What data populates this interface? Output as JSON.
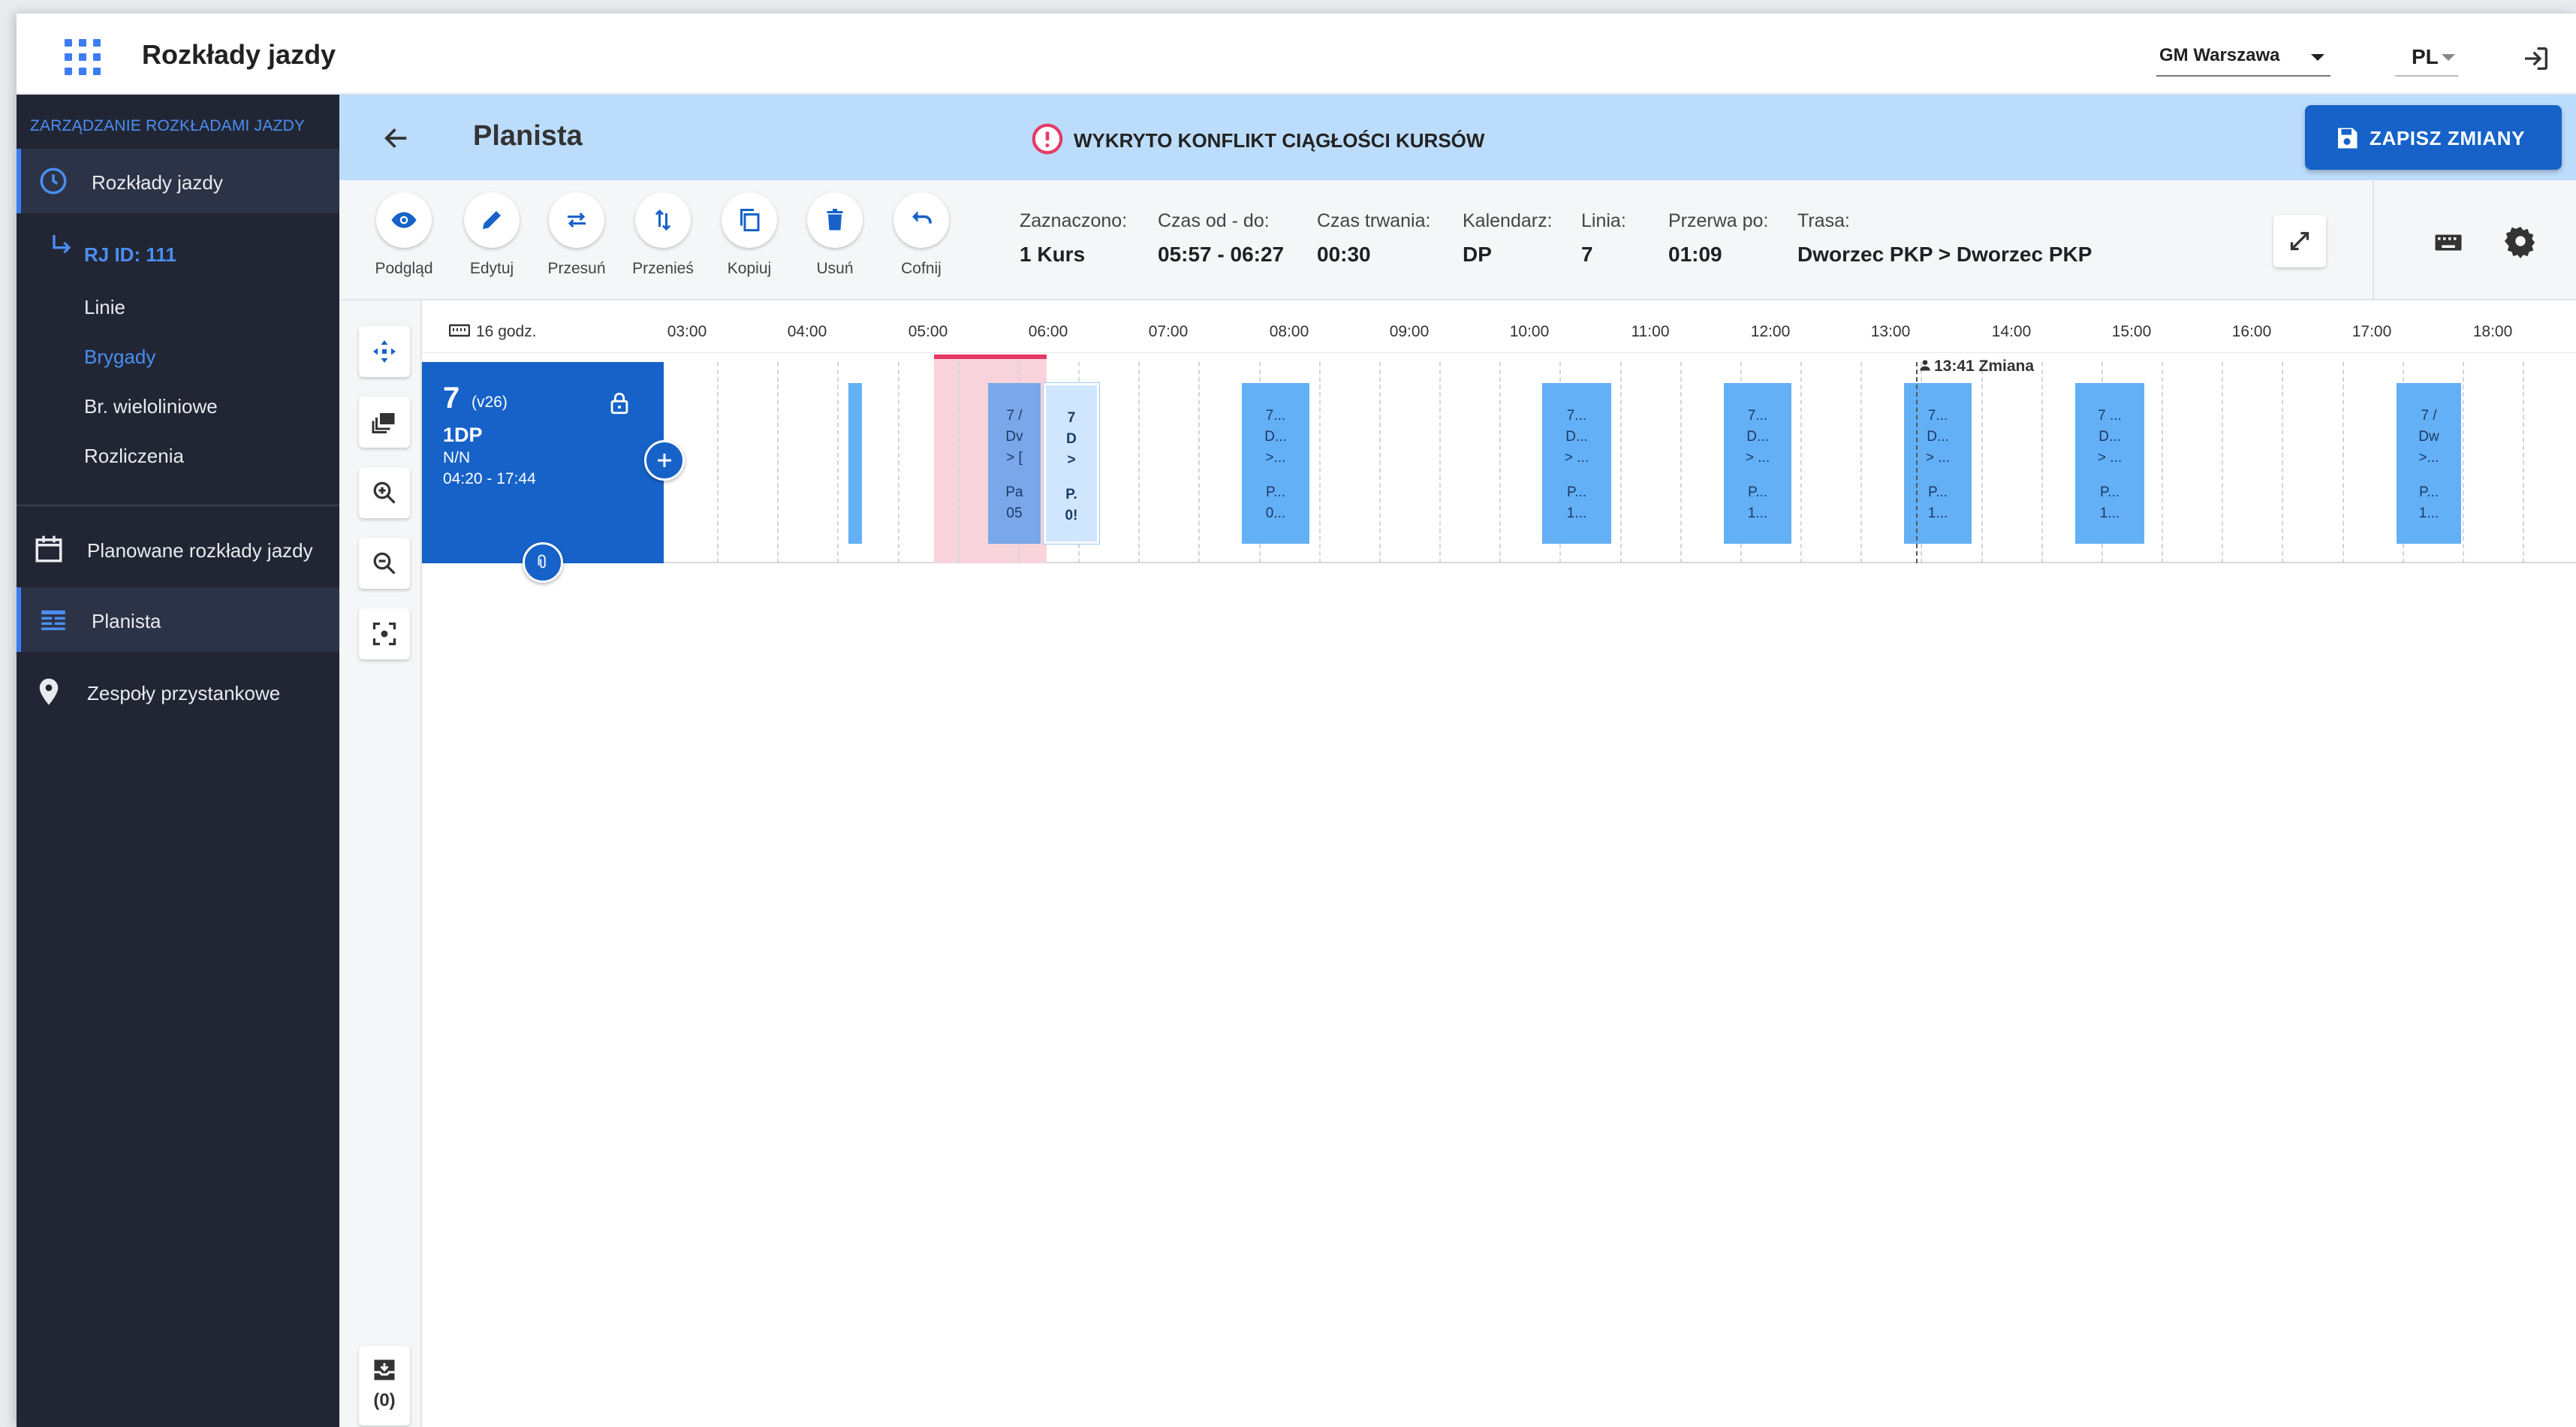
{
  "app": {
    "title": "Rozkłady jazdy",
    "org": "GM Warszawa",
    "lang": "PL"
  },
  "sidebar": {
    "header": "ZARZĄDZANIE ROZKŁADAMI JAZDY",
    "items": [
      {
        "label": "Rozkłady jazdy",
        "icon": "clock-icon"
      },
      {
        "label": "Planowane rozkłady jazdy",
        "icon": "calendar-icon"
      },
      {
        "label": "Planista",
        "icon": "table-icon"
      },
      {
        "label": "Zespoły przystankowe",
        "icon": "pin-icon"
      }
    ],
    "rj": "RJ ID: 111",
    "subitems": [
      "Linie",
      "Brygady",
      "Br. wieloliniowe",
      "Rozliczenia"
    ]
  },
  "header": {
    "title": "Planista",
    "conflict": "WYKRYTO KONFLIKT CIĄGŁOŚCI KURSÓW",
    "save": "ZAPISZ ZMIANY"
  },
  "toolbar": {
    "tools": [
      "Podgląd",
      "Edytuj",
      "Przesuń",
      "Przenieś",
      "Kopiuj",
      "Usuń",
      "Cofnij"
    ],
    "info": [
      {
        "k": "Zaznaczono:",
        "v": "1 Kurs"
      },
      {
        "k": "Czas od - do:",
        "v": "05:57 - 06:27"
      },
      {
        "k": "Czas trwania:",
        "v": "00:30"
      },
      {
        "k": "Kalendarz:",
        "v": "DP"
      },
      {
        "k": "Linia:",
        "v": "7"
      },
      {
        "k": "Przerwa po:",
        "v": "01:09"
      },
      {
        "k": "Trasa:",
        "v": "Dworzec PKP > Dworzec PKP"
      }
    ]
  },
  "timeline": {
    "scale": "16 godz.",
    "hours": [
      "03:00",
      "04:00",
      "05:00",
      "06:00",
      "07:00",
      "08:00",
      "09:00",
      "10:00",
      "11:00",
      "12:00",
      "13:00",
      "14:00",
      "15:00",
      "16:00",
      "17:00",
      "18:00"
    ],
    "change": "13:41 Zmiana",
    "brigade": {
      "num": "7",
      "ver": "(v26)",
      "code": "1DP",
      "nn": "N/N",
      "time": "04:20 - 17:44"
    },
    "courses": [
      {
        "l": [
          "",
          "",
          "",
          "",
          ""
        ]
      },
      {
        "l": [
          "7 /",
          "Dv",
          "> [",
          "Pa",
          "05"
        ]
      },
      {
        "l": [
          "7",
          "D",
          ">",
          "P.",
          "0!"
        ]
      },
      {
        "l": [
          "7...",
          "D...",
          ">...",
          "P...",
          "0..."
        ]
      },
      {
        "l": [
          "7...",
          "D...",
          "> ...",
          "P...",
          "1..."
        ]
      },
      {
        "l": [
          "7...",
          "D...",
          "> ...",
          "P...",
          "1..."
        ]
      },
      {
        "l": [
          "7...",
          "D...",
          "> ...",
          "P...",
          "1..."
        ]
      },
      {
        "l": [
          "7 ...",
          "D...",
          "> ...",
          "P...",
          "1..."
        ]
      },
      {
        "l": [
          "7 /",
          "Dw",
          ">...",
          "P...",
          "1..."
        ]
      }
    ]
  },
  "bottom_counter": "(0)"
}
